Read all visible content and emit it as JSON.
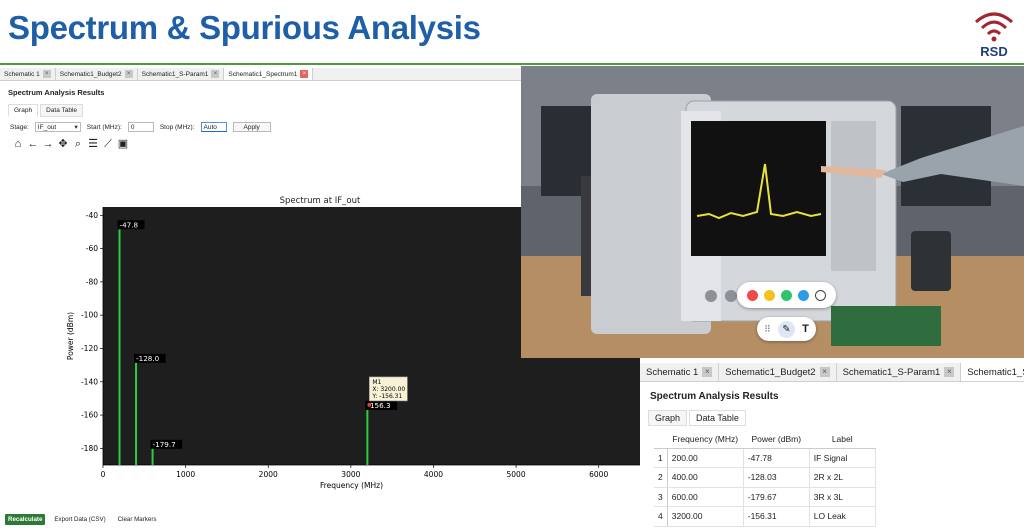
{
  "slide": {
    "title": "Spectrum & Spurious Analysis",
    "logo_text": "RSD"
  },
  "app": {
    "tabs": [
      {
        "label": "Schematic 1",
        "active": false
      },
      {
        "label": "Schematic1_Budget2",
        "active": false
      },
      {
        "label": "Schematic1_S-Param1",
        "active": false
      },
      {
        "label": "Schematic1_Spectrum1",
        "active": true
      }
    ],
    "section_title": "Spectrum Analysis Results",
    "subtabs": {
      "graph": "Graph",
      "table": "Data Table"
    },
    "controls": {
      "stage_label": "Stage:",
      "stage_value": "IF_out",
      "start_label": "Start (MHz):",
      "start_value": "0",
      "stop_label": "Stop (MHz):",
      "stop_value": "Auto",
      "apply": "Apply"
    },
    "toolbar_icons": [
      "home-icon",
      "back-arrow-icon",
      "forward-arrow-icon",
      "pan-icon",
      "zoom-icon",
      "settings-sliders-icon",
      "line-chart-icon",
      "save-icon"
    ],
    "bottom": {
      "recalc": "Recalculate",
      "export": "Export Data (CSV)",
      "clear": "Clear Markers"
    }
  },
  "chart_data": {
    "type": "bar",
    "title": "Spectrum at IF_out",
    "xlabel": "Frequency (MHz)",
    "ylabel": "Power (dBm)",
    "xlim": [
      0,
      6500
    ],
    "ylim": [
      -190,
      -35
    ],
    "xticks": [
      0,
      1000,
      2000,
      3000,
      4000,
      5000,
      6000
    ],
    "yticks": [
      -40,
      -60,
      -80,
      -100,
      -120,
      -140,
      -160,
      -180
    ],
    "x": [
      200,
      400,
      600,
      3200
    ],
    "values": [
      -47.78,
      -128.03,
      -179.67,
      -156.31
    ],
    "data_labels": [
      "-47.8",
      "-128.0",
      "-179.7",
      "-156.3"
    ],
    "marker": {
      "name": "M1",
      "x_label": "X: 3200.00",
      "y_label": "Y: -156.31",
      "x": 3200,
      "y": -156.31
    },
    "background": "#1e1e1e",
    "bar_color": "#2ecc40",
    "grid": false
  },
  "picker": {
    "colors": [
      "#ef4b4b",
      "#f4c21c",
      "#2fc46b",
      "#2b9de8",
      "#ffffff"
    ],
    "icons": [
      "grip-icon",
      "pen-icon",
      "text-icon"
    ],
    "text_glyph": "T"
  },
  "zoom": {
    "tabs": [
      {
        "label": "Schematic 1",
        "active": false
      },
      {
        "label": "Schematic1_Budget2",
        "active": false
      },
      {
        "label": "Schematic1_S-Param1",
        "active": false
      },
      {
        "label": "Schematic1_Spectrum1",
        "active": true
      }
    ],
    "section_title": "Spectrum Analysis Results",
    "subtabs": {
      "graph": "Graph",
      "table": "Data Table"
    },
    "table": {
      "headers": [
        "Frequency (MHz)",
        "Power (dBm)",
        "Label"
      ],
      "rows": [
        {
          "idx": "1",
          "freq": "200.00",
          "power": "-47.78",
          "label": "IF Signal"
        },
        {
          "idx": "2",
          "freq": "400.00",
          "power": "-128.03",
          "label": "2R x 2L"
        },
        {
          "idx": "3",
          "freq": "600.00",
          "power": "-179.67",
          "label": "3R x 3L"
        },
        {
          "idx": "4",
          "freq": "3200.00",
          "power": "-156.31",
          "label": "LO Leak"
        }
      ]
    }
  }
}
